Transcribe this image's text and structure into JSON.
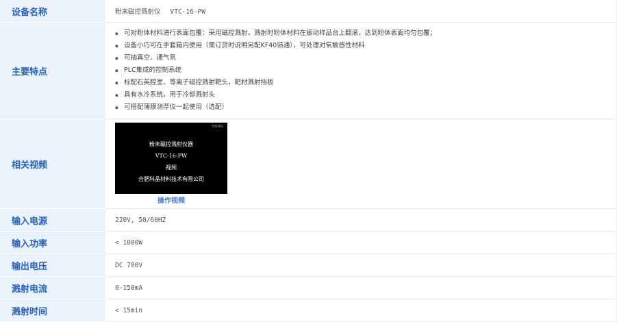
{
  "labels": {
    "device_name": "设备名称",
    "main_features": "主要特点",
    "related_video": "相关视频",
    "input_power_supply": "输入电源",
    "input_power": "输入功率",
    "output_voltage": "输出电压",
    "sputter_current": "溅射电流",
    "sputter_time": "溅射时间"
  },
  "device": {
    "name": "粉末磁控溅射仪",
    "model": "VTC-16-PW"
  },
  "features": [
    "可对粉体材料进行表面包覆：采用磁控溅射，溅射时粉体材料在振动样品台上翻滚，达到粉体表面均匀包覆；",
    "设备小巧可在手套箱内使用（需订货时说明另配KF40馈通），可处理对氧敏感性材料",
    "可抽真空、通气氛",
    "PLC集成的控制系统",
    "标配石英腔室、等离子磁控溅射靶头，靶材溅射挡板",
    "具有水冷系统，用于冷却溅射头",
    "可搭配薄膜测厚仪一起使用（选配）"
  ],
  "video": {
    "logo": "YOUKU",
    "lines": [
      "粉末磁控溅射仪器",
      "VTC-16-PW",
      "视频",
      "合肥科晶材料技术有限公司"
    ],
    "caption": "操作视频"
  },
  "specs": {
    "input_power_supply": "220V, 50/60HZ",
    "input_power": "< 1000W",
    "output_voltage": "DC 700V",
    "sputter_current": "0-150mA",
    "sputter_time": "< 15min"
  }
}
